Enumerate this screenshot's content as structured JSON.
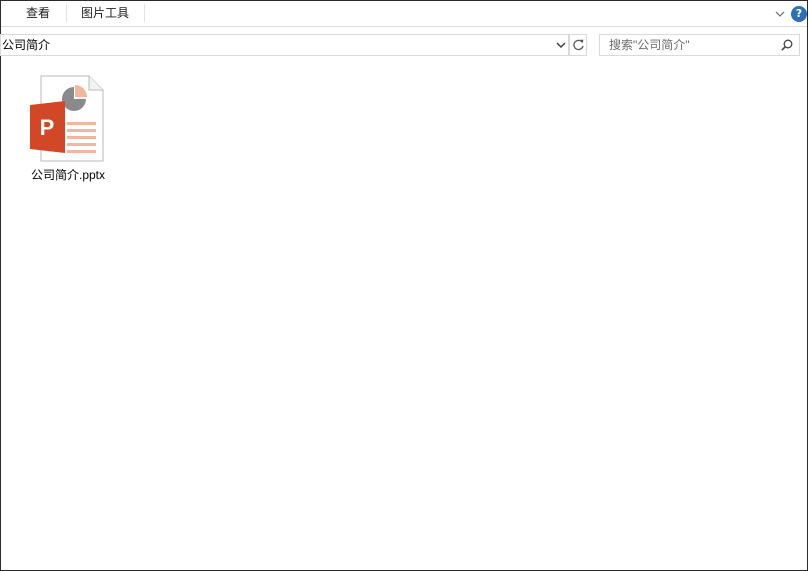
{
  "ribbon": {
    "tabs": [
      {
        "label": "查看"
      },
      {
        "label": "图片工具"
      }
    ],
    "help_label": "?"
  },
  "address_bar": {
    "path": "公司简介"
  },
  "search": {
    "placeholder": "搜索\"公司简介\""
  },
  "files": [
    {
      "name": "公司简介.pptx",
      "type": "powerpoint",
      "icon": "powerpoint-file-icon"
    }
  ],
  "colors": {
    "powerpoint_red": "#d24726",
    "powerpoint_light": "#f2b69e",
    "help_blue": "#2b6fb5",
    "pie_gray": "#8a8a8a"
  }
}
